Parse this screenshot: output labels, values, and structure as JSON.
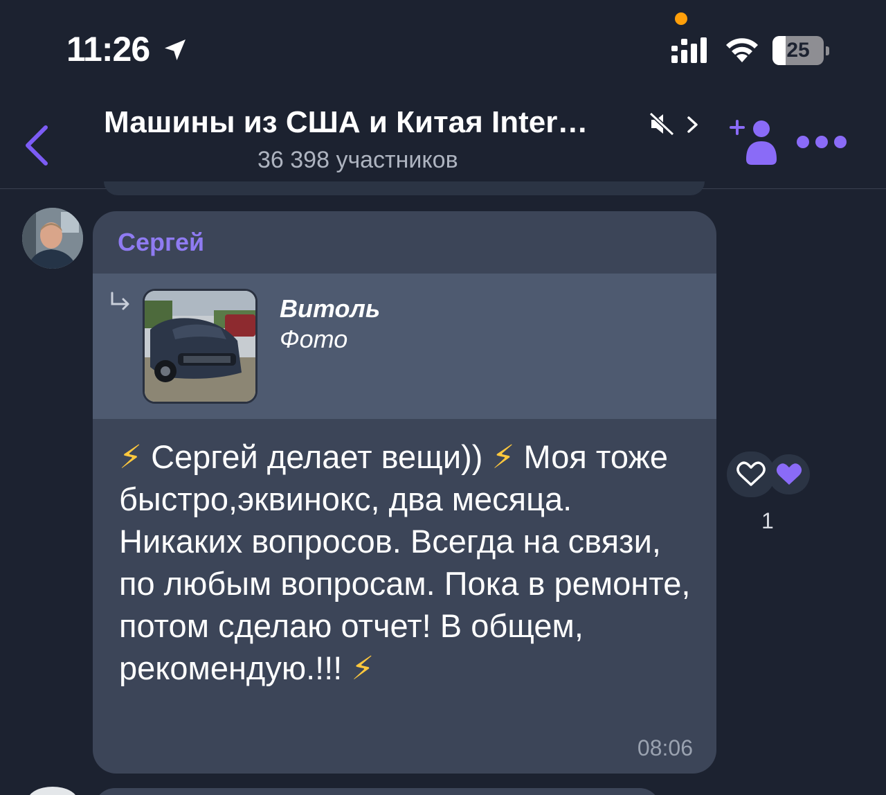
{
  "status_bar": {
    "time": "11:26",
    "battery_level": "25",
    "battery_fraction": 0.25,
    "icons": [
      "location-arrow-icon",
      "signal-icon",
      "wifi-icon",
      "battery-icon"
    ]
  },
  "header": {
    "title": "Машины из США и Китая Inter…",
    "subtitle": "36 398 участников",
    "icons": [
      "back-chevron-icon",
      "muted-speaker-icon",
      "chevron-right-icon",
      "add-member-icon",
      "more-dots-icon"
    ]
  },
  "message": {
    "sender": "Сергей",
    "forward": {
      "author": "Витоль",
      "type": "Фото"
    },
    "text_segments": [
      {
        "text": "⚡",
        "bolt": true
      },
      {
        "text": " Сергей делает вещи)) ",
        "bolt": false
      },
      {
        "text": "⚡",
        "bolt": true
      },
      {
        "text": "  Моя тоже быстро,эквинокс, два месяца. Никаких вопросов. Всегда на связи, по любым вопросам. Пока в ремонте, потом сделаю отчет! В общем, рекомендую.!!!  ",
        "bolt": false
      },
      {
        "text": "⚡",
        "bolt": true
      }
    ],
    "time": "08:06"
  },
  "reactions": {
    "count": "1",
    "icons": [
      "heart-outline-icon",
      "heart-filled-icon"
    ]
  },
  "colors": {
    "background": "#1c2230",
    "bubble": "#3c4558",
    "forward_block": "#4e5a70",
    "accent": "#8f7bf2",
    "bolt": "#ffc83d"
  }
}
